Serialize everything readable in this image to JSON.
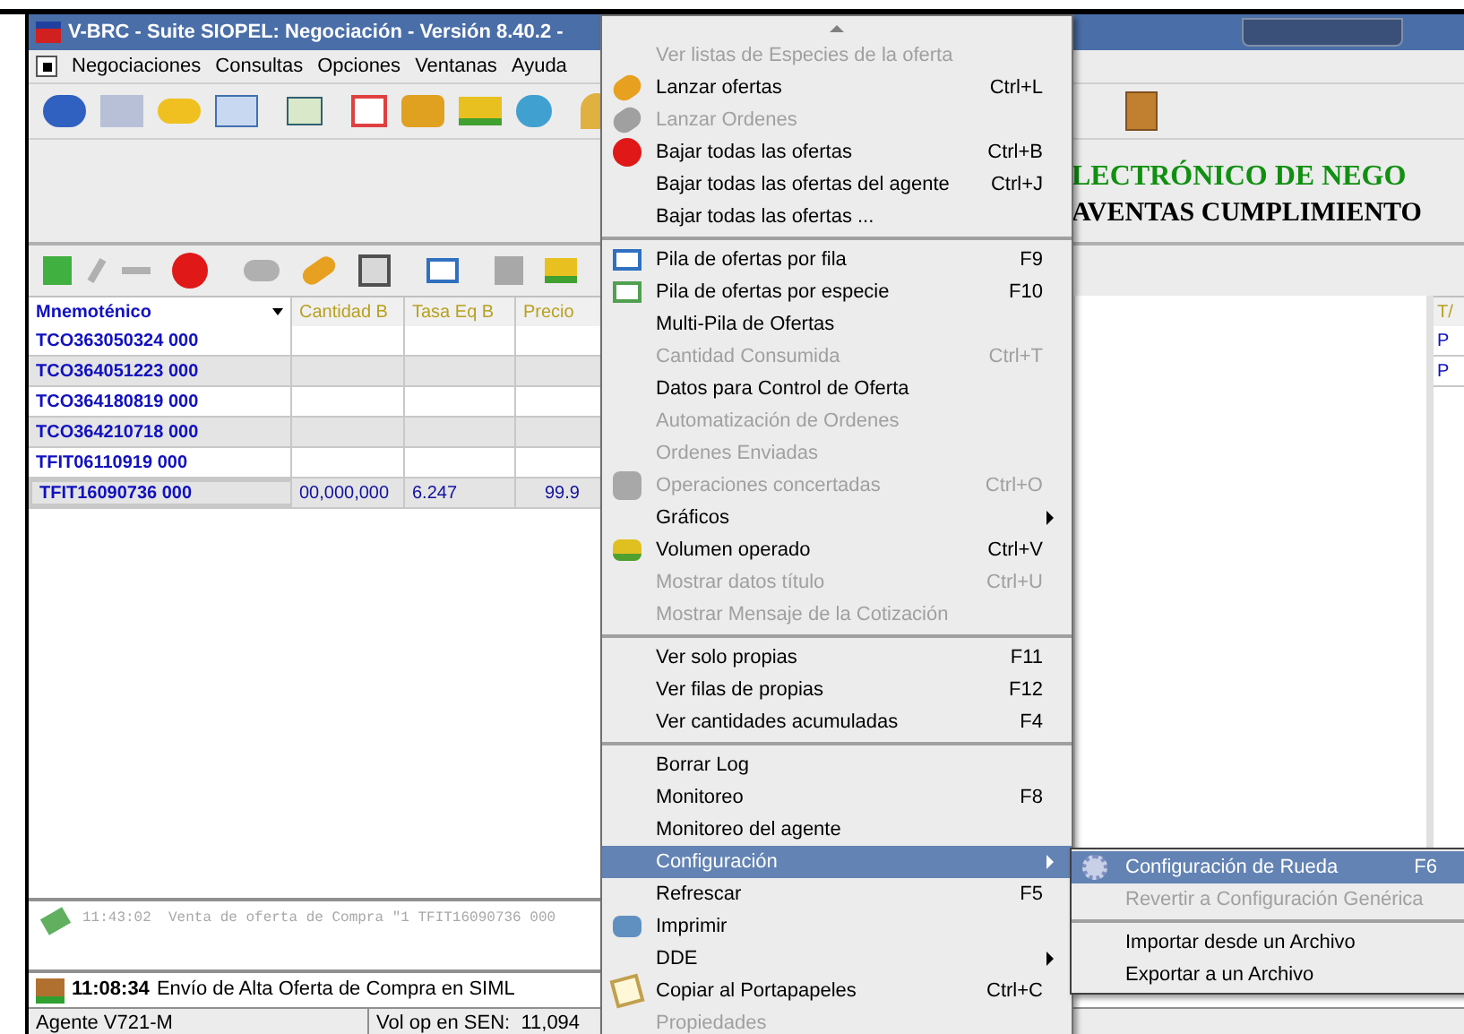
{
  "window": {
    "title": "V-BRC - Suite SIOPEL: Negociación - Versión 8.40.2 -"
  },
  "menu_bar": [
    {
      "label": "Negociaciones"
    },
    {
      "label": "Consultas"
    },
    {
      "label": "Opciones"
    },
    {
      "label": "Ventanas"
    },
    {
      "label": "Ayuda"
    }
  ],
  "banner": {
    "line_1": "LECTRÓNICO DE NEGO",
    "line_2": "AVENTAS CUMPLIMIENTO"
  },
  "table": {
    "columns": [
      "Mnemoténico",
      "Cantidad B",
      "Tasa Eq B",
      "Precio"
    ],
    "rows": [
      {
        "cells": [
          "TCO363050324 000",
          "",
          "",
          ""
        ],
        "selected": false
      },
      {
        "cells": [
          "TCO364051223 000",
          "",
          "",
          ""
        ],
        "selected": false
      },
      {
        "cells": [
          "TCO364180819 000",
          "",
          "",
          ""
        ],
        "selected": false
      },
      {
        "cells": [
          "TCO364210718 000",
          "",
          "",
          ""
        ],
        "selected": false
      },
      {
        "cells": [
          "TFIT06110919 000",
          "",
          "",
          ""
        ],
        "selected": false
      },
      {
        "cells": [
          "TFIT16090736 000",
          "00,000,000",
          "6.247",
          "99.9"
        ],
        "selected": true
      }
    ]
  },
  "right_table": {
    "column": "T/",
    "rows": [
      "P",
      "P"
    ]
  },
  "log": {
    "time": "11:43:02",
    "message": "Venta de oferta de Compra \"1 TFIT16090736 000"
  },
  "status_message": {
    "time": "11:08:34",
    "message": "Envío de Alta Oferta de Compra en SIML"
  },
  "status_bar": [
    "Agente V721-M",
    "Vol op en SEN:  11,094"
  ],
  "context_menu": [
    {
      "kind": "item",
      "label": "Ver listas de Especies de la oferta",
      "disabled": true
    },
    {
      "kind": "item",
      "label": "Lanzar ofertas",
      "shortcut": "Ctrl+L",
      "disabled": false
    },
    {
      "kind": "item",
      "label": "Lanzar Ordenes",
      "disabled": true
    },
    {
      "kind": "item",
      "label": "Bajar todas las ofertas",
      "shortcut": "Ctrl+B",
      "disabled": false
    },
    {
      "kind": "item",
      "label": "Bajar todas las ofertas del agente",
      "shortcut": "Ctrl+J",
      "disabled": false
    },
    {
      "kind": "item",
      "label": "Bajar todas las ofertas ...",
      "disabled": false
    },
    {
      "kind": "separator"
    },
    {
      "kind": "item",
      "label": "Pila de ofertas por fila",
      "shortcut": "F9",
      "disabled": false
    },
    {
      "kind": "item",
      "label": "Pila de ofertas por especie",
      "shortcut": "F10",
      "disabled": false
    },
    {
      "kind": "item",
      "label": "Multi-Pila de Ofertas",
      "disabled": false
    },
    {
      "kind": "item",
      "label": "Cantidad Consumida",
      "shortcut": "Ctrl+T",
      "disabled": true
    },
    {
      "kind": "item",
      "label": "Datos para Control de Oferta",
      "disabled": false
    },
    {
      "kind": "item",
      "label": "Automatización de Ordenes",
      "disabled": true
    },
    {
      "kind": "item",
      "label": "Ordenes Enviadas",
      "disabled": true
    },
    {
      "kind": "item",
      "label": "Operaciones concertadas",
      "shortcut": "Ctrl+O",
      "disabled": true
    },
    {
      "kind": "item",
      "label": "Gráficos",
      "submenu": true,
      "disabled": false
    },
    {
      "kind": "item",
      "label": "Volumen operado",
      "shortcut": "Ctrl+V",
      "disabled": false
    },
    {
      "kind": "item",
      "label": "Mostrar datos título",
      "shortcut": "Ctrl+U",
      "disabled": true
    },
    {
      "kind": "item",
      "label": "Mostrar Mensaje de la Cotización",
      "disabled": true
    },
    {
      "kind": "separator"
    },
    {
      "kind": "item",
      "label": "Ver solo propias",
      "shortcut": "F11",
      "disabled": false
    },
    {
      "kind": "item",
      "label": "Ver filas de propias",
      "shortcut": "F12",
      "disabled": false
    },
    {
      "kind": "item",
      "label": "Ver cantidades acumuladas",
      "shortcut": "F4",
      "disabled": false
    },
    {
      "kind": "separator"
    },
    {
      "kind": "item",
      "label": "Borrar Log",
      "disabled": false
    },
    {
      "kind": "item",
      "label": "Monitoreo",
      "shortcut": "F8",
      "disabled": false
    },
    {
      "kind": "item",
      "label": "Monitoreo del agente",
      "disabled": false
    },
    {
      "kind": "item",
      "label": "Configuración",
      "submenu": true,
      "selected": true,
      "disabled": false
    },
    {
      "kind": "item",
      "label": "Refrescar",
      "shortcut": "F5",
      "disabled": false
    },
    {
      "kind": "item",
      "label": "Imprimir",
      "disabled": false
    },
    {
      "kind": "item",
      "label": "DDE",
      "submenu": true,
      "disabled": false
    },
    {
      "kind": "item",
      "label": "Copiar al Portapapeles",
      "shortcut": "Ctrl+C",
      "disabled": false
    },
    {
      "kind": "item",
      "label": "Propiedades",
      "disabled": true
    }
  ],
  "submenu": [
    {
      "kind": "item",
      "label": "Configuración de Rueda",
      "shortcut": "F6",
      "selected": true,
      "disabled": false
    },
    {
      "kind": "item",
      "label": "Revertir a Configuración Genérica",
      "selected": false,
      "disabled": true
    },
    {
      "kind": "separator"
    },
    {
      "kind": "item",
      "label": "Importar desde un Archivo",
      "selected": false,
      "disabled": false
    },
    {
      "kind": "item",
      "label": "Exportar a un Archivo",
      "selected": false,
      "disabled": false
    }
  ]
}
